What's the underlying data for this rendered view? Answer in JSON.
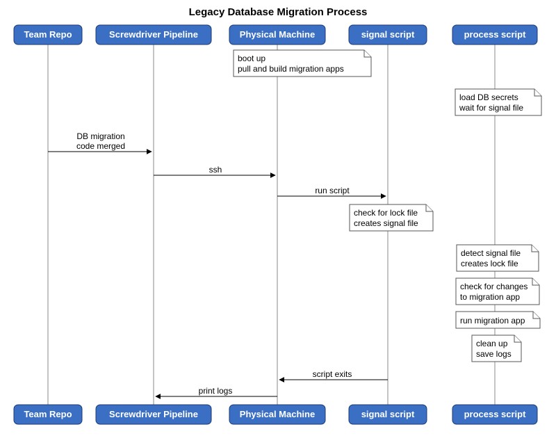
{
  "title": "Legacy Database Migration Process",
  "participants": {
    "p1": "Team Repo",
    "p2": "Screwdriver Pipeline",
    "p3": "Physical Machine",
    "p4": "signal script",
    "p5": "process script"
  },
  "notes": {
    "n1a": "boot up",
    "n1b": "pull and build migration apps",
    "n2a": "load DB secrets",
    "n2b": "wait for signal file",
    "n3a": "check for lock file",
    "n3b": "creates signal file",
    "n4a": "detect signal file",
    "n4b": "creates lock file",
    "n5a": "check for changes",
    "n5b": "to migration app",
    "n6": "run migration app",
    "n7a": "clean up",
    "n7b": "save logs"
  },
  "messages": {
    "m1a": "DB migration",
    "m1b": "code merged",
    "m2": "ssh",
    "m3": "run script",
    "m4": "script exits",
    "m5": "print logs"
  }
}
